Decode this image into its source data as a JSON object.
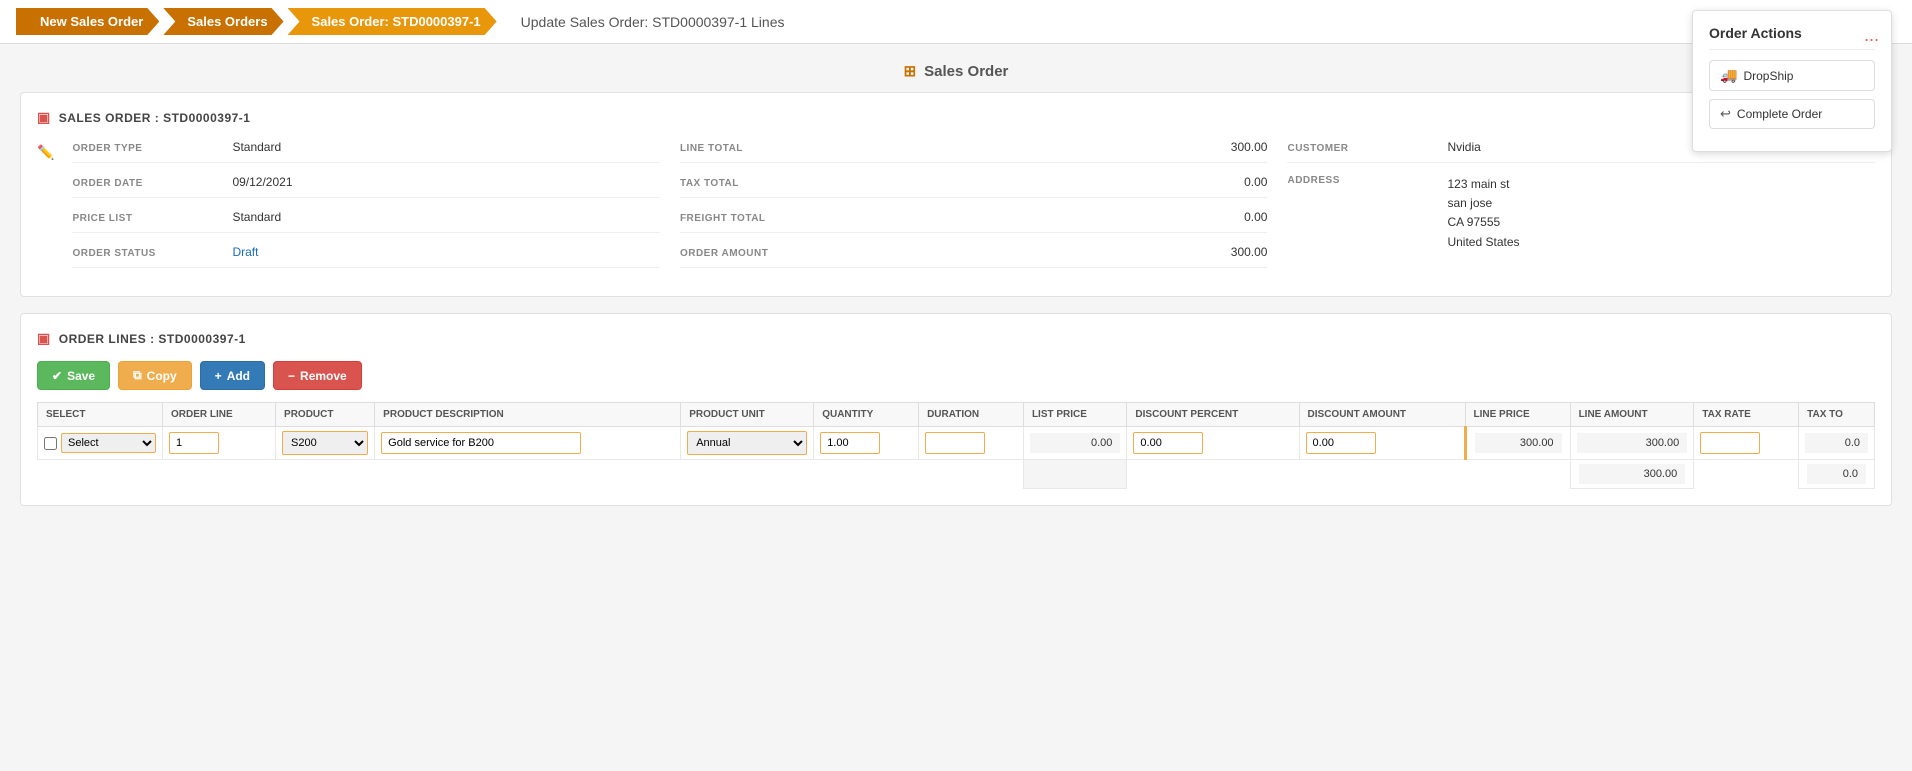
{
  "breadcrumb": {
    "items": [
      {
        "label": "New Sales Order",
        "active": false
      },
      {
        "label": "Sales Orders",
        "active": false
      },
      {
        "label": "Sales Order: STD0000397-1",
        "active": true
      }
    ],
    "page_title": "Update Sales Order: STD0000397-1 Lines"
  },
  "page_center_title": "Sales Order",
  "order_actions": {
    "title": "Order Actions",
    "dropship_label": "DropShip",
    "complete_order_label": "Complete Order",
    "more_dots": "..."
  },
  "sales_order_section": {
    "header": "SALES ORDER : STD0000397-1",
    "fields": {
      "order_type_label": "ORDER TYPE",
      "order_type_value": "Standard",
      "order_date_label": "ORDER DATE",
      "order_date_value": "09/12/2021",
      "price_list_label": "PRICE LIST",
      "price_list_value": "Standard",
      "order_status_label": "ORDER STATUS",
      "order_status_value": "Draft",
      "line_total_label": "LINE TOTAL",
      "line_total_value": "300.00",
      "tax_total_label": "TAX TOTAL",
      "tax_total_value": "0.00",
      "freight_total_label": "FREIGHT TOTAL",
      "freight_total_value": "0.00",
      "order_amount_label": "ORDER AMOUNT",
      "order_amount_value": "300.00",
      "customer_label": "CUSTOMER",
      "customer_value": "Nvidia",
      "address_label": "ADDRESS",
      "address_line1": "123 main st",
      "address_line2": "san jose",
      "address_line3": "CA 97555",
      "address_line4": "United States"
    }
  },
  "order_lines_section": {
    "header": "ORDER LINES : STD0000397-1",
    "toolbar": {
      "save_label": "Save",
      "copy_label": "Copy",
      "add_label": "Add",
      "remove_label": "Remove"
    },
    "table": {
      "columns": [
        "SELECT",
        "ORDER LINE",
        "PRODUCT",
        "PRODUCT DESCRIPTION",
        "PRODUCT UNIT",
        "QUANTITY",
        "DURATION",
        "LIST PRICE",
        "DISCOUNT PERCENT",
        "DISCOUNT AMOUNT",
        "LINE PRICE",
        "LINE AMOUNT",
        "TAX RATE",
        "TAX TO"
      ],
      "rows": [
        {
          "select": "",
          "order_line": "1",
          "product": "S200",
          "product_description": "Gold service for B200",
          "product_unit": "Annual",
          "quantity": "1.00",
          "duration": "",
          "list_price": "0.00",
          "discount_percent": "0.00",
          "discount_amount": "0.00",
          "line_price": "300.00",
          "line_amount": "300.00",
          "tax_rate": "",
          "tax_to": "0.0"
        }
      ],
      "summary": {
        "line_amount_total": "300.00",
        "tax_to_total": "0.0"
      }
    }
  }
}
